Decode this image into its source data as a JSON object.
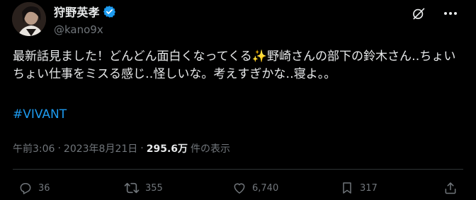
{
  "author": {
    "display_name": "狩野英孝",
    "handle": "@kano9x",
    "verified_icon": "verified-badge-icon"
  },
  "tweet": {
    "text_before_emoji": "最新話見ました！どんどん面白くなってくる",
    "emoji": "✨",
    "text_after_emoji": "野崎さんの部下の鈴木さん‥ちょいちょい仕事をミスる感じ‥怪しいな。考えすぎかな‥寝よ。。",
    "hashtag": "#VIVANT"
  },
  "meta": {
    "time": "午前3:06",
    "separator1": "·",
    "date": "2023年8月21日",
    "separator2": "·",
    "views_count": "295.6万",
    "views_label": "件の表示"
  },
  "actions": {
    "replies": "36",
    "reposts": "355",
    "likes": "6,740",
    "bookmarks": "317"
  },
  "colors": {
    "background": "#000000",
    "text": "#e7e9ea",
    "muted": "#71767b",
    "accent": "#1d9bf0",
    "divider": "#2f3336"
  }
}
